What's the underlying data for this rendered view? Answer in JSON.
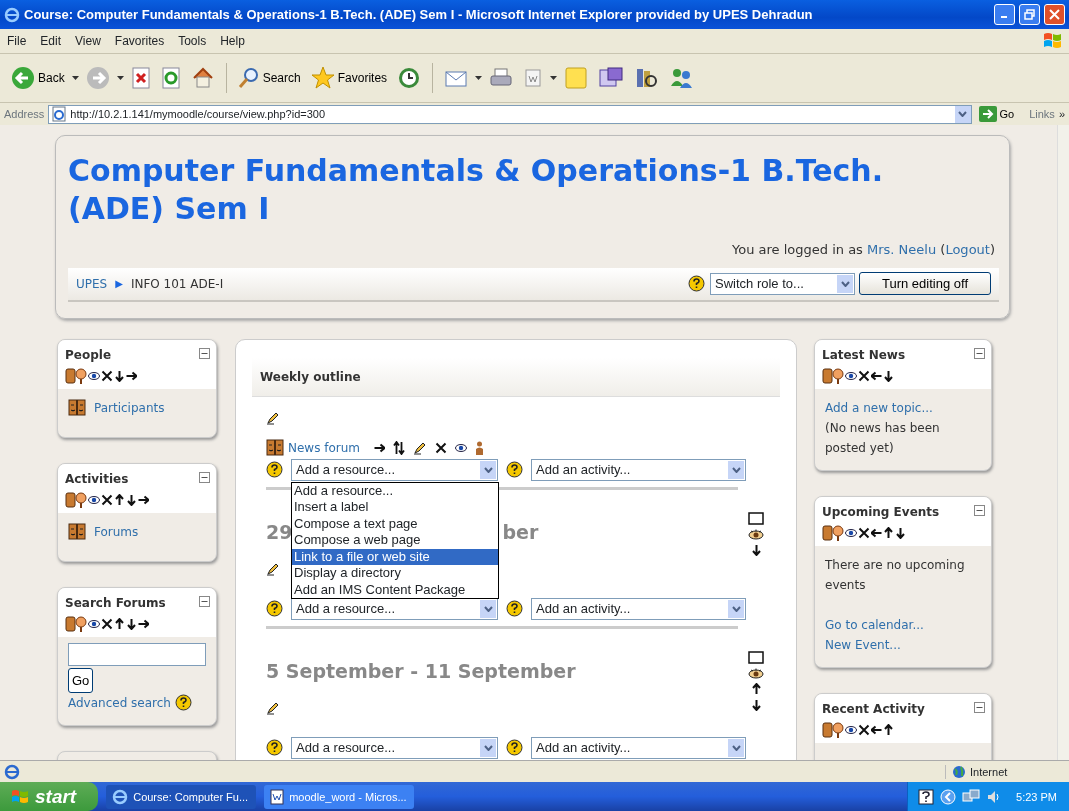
{
  "window": {
    "title": "Course: Computer Fundamentals & Operations-1 B.Tech. (ADE) Sem I - Microsoft Internet Explorer provided by UPES Dehradun"
  },
  "menu": [
    "File",
    "Edit",
    "View",
    "Favorites",
    "Tools",
    "Help"
  ],
  "toolbar": [
    {
      "kind": "back",
      "label": "Back",
      "caret": true
    },
    {
      "kind": "forward",
      "caret": true
    },
    {
      "kind": "stop"
    },
    {
      "kind": "refresh"
    },
    {
      "kind": "home"
    },
    {
      "kind": "sep"
    },
    {
      "kind": "search",
      "label": "Search"
    },
    {
      "kind": "favorites",
      "label": "Favorites"
    },
    {
      "kind": "history"
    },
    {
      "kind": "sep"
    },
    {
      "kind": "mail",
      "caret": true
    },
    {
      "kind": "print"
    },
    {
      "kind": "word",
      "caret": true
    },
    {
      "kind": "note"
    },
    {
      "kind": "messenger"
    },
    {
      "kind": "research"
    },
    {
      "kind": "people"
    }
  ],
  "address": {
    "label": "Address",
    "url": "http://10.2.1.141/mymoodle/course/view.php?id=300",
    "go": "Go",
    "links": "Links",
    "more": "»"
  },
  "course_title": "Computer Fundamentals & Operations-1 B.Tech. (ADE) Sem I",
  "login": [
    {
      "kind": "text",
      "text": "You are logged in as "
    },
    {
      "kind": "link",
      "text": "Mrs. Neelu"
    },
    {
      "kind": "text",
      "text": " ("
    },
    {
      "kind": "link",
      "text": "Logout"
    },
    {
      "kind": "text",
      "text": ")"
    }
  ],
  "breadcrumb": [
    {
      "label": "UPES",
      "link": true,
      "separator": "▶"
    },
    {
      "label": "INFO 101 ADE-I",
      "link": false
    }
  ],
  "role_select": "Switch role to...",
  "editing_button": "Turn editing off",
  "left_blocks": [
    {
      "kind": "links",
      "title": "People",
      "controls": [
        {
          "kind": "roles"
        },
        {
          "kind": "hide"
        },
        {
          "kind": "delete"
        },
        {
          "kind": "down"
        },
        {
          "kind": "right"
        }
      ],
      "items": [
        {
          "label": "Participants"
        }
      ]
    },
    {
      "kind": "links",
      "title": "Activities",
      "controls": [
        {
          "kind": "roles"
        },
        {
          "kind": "hide"
        },
        {
          "kind": "delete"
        },
        {
          "kind": "up"
        },
        {
          "kind": "down"
        },
        {
          "kind": "right"
        }
      ],
      "items": [
        {
          "label": "Forums"
        }
      ]
    },
    {
      "kind": "search",
      "title": "Search Forums",
      "controls": [
        {
          "kind": "roles"
        },
        {
          "kind": "hide"
        },
        {
          "kind": "delete"
        },
        {
          "kind": "up"
        },
        {
          "kind": "down"
        },
        {
          "kind": "right"
        }
      ],
      "button": "Go",
      "advanced": "Advanced search"
    },
    {
      "kind": "empty"
    }
  ],
  "outline": {
    "title": "Weekly outline",
    "sections": [
      {
        "activities": [
          {
            "label": "News forum",
            "controls": [
              {
                "kind": "right"
              },
              {
                "kind": "move"
              },
              {
                "kind": "edit"
              },
              {
                "kind": "delete"
              },
              {
                "kind": "hide"
              },
              {
                "kind": "group"
              }
            ]
          }
        ],
        "resource": "Add a resource...",
        "activity": "Add an activity...",
        "dropdown": [
          {
            "label": "Add a resource...",
            "selected": false
          },
          {
            "label": "Insert a label",
            "selected": false
          },
          {
            "label": "Compose a text page",
            "selected": false
          },
          {
            "label": "Compose a web page",
            "selected": false
          },
          {
            "label": "Link to a file or web site",
            "selected": true
          },
          {
            "label": "Display a directory",
            "selected": false
          },
          {
            "label": "Add an IMS Content Package",
            "selected": false
          }
        ]
      },
      {
        "heading": [
          "29",
          "ber"
        ],
        "side_controls": [
          {
            "kind": "highlight"
          },
          {
            "kind": "eye"
          },
          {
            "kind": "down"
          }
        ],
        "resource": "Add a resource...",
        "activity": "Add an activity..."
      },
      {
        "heading": [
          "5 September - 11 September"
        ],
        "side_controls": [
          {
            "kind": "highlight"
          },
          {
            "kind": "eye"
          },
          {
            "kind": "up"
          },
          {
            "kind": "down"
          }
        ],
        "resource": "Add a resource...",
        "activity": "Add an activity..."
      }
    ]
  },
  "right_blocks": [
    {
      "title": "Latest News",
      "controls": [
        {
          "kind": "roles"
        },
        {
          "kind": "hide"
        },
        {
          "kind": "delete"
        },
        {
          "kind": "left"
        },
        {
          "kind": "down"
        }
      ],
      "items": [
        {
          "kind": "link",
          "text": "Add a new topic..."
        },
        {
          "kind": "text",
          "text": "(No news has been posted yet)"
        }
      ]
    },
    {
      "title": "Upcoming Events",
      "controls": [
        {
          "kind": "roles"
        },
        {
          "kind": "hide"
        },
        {
          "kind": "delete"
        },
        {
          "kind": "left"
        },
        {
          "kind": "up"
        },
        {
          "kind": "down"
        }
      ],
      "items": [
        {
          "kind": "text",
          "text": "There are no upcoming events"
        },
        {
          "kind": "gap"
        },
        {
          "kind": "link",
          "text": "Go to calendar..."
        },
        {
          "kind": "link",
          "text": "New Event..."
        }
      ]
    },
    {
      "title": "Recent Activity",
      "controls": [
        {
          "kind": "roles"
        },
        {
          "kind": "hide"
        },
        {
          "kind": "delete"
        },
        {
          "kind": "left"
        },
        {
          "kind": "up"
        }
      ]
    }
  ],
  "status_bar": {
    "zone": "Internet"
  },
  "taskbar": {
    "start": "start",
    "tasks": [
      {
        "kind": "ie",
        "label": "Course: Computer Fu...",
        "active": true
      },
      {
        "kind": "word",
        "label": "moodle_word - Micros...",
        "active": false
      }
    ],
    "clock": "5:23 PM"
  }
}
